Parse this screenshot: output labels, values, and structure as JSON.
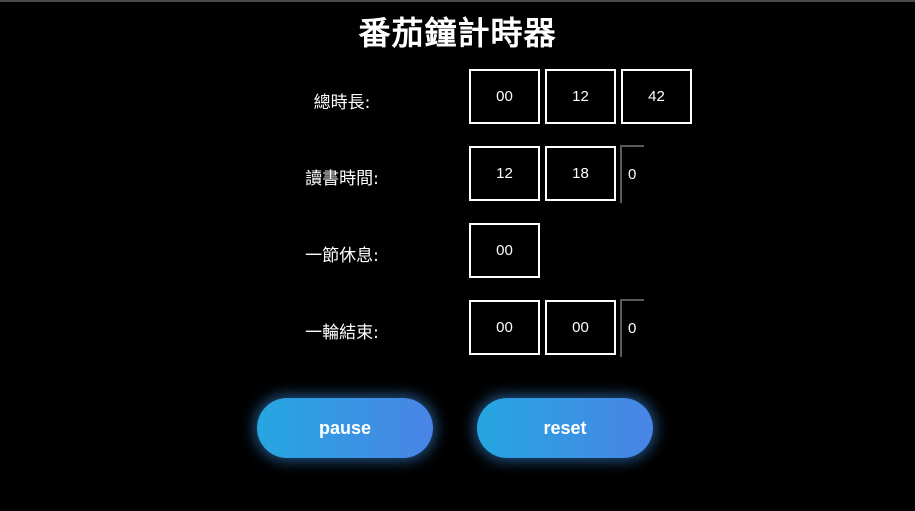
{
  "title": "番茄鐘計時器",
  "rows": [
    {
      "label": "總時長:",
      "cells": [
        "00",
        "12",
        "42"
      ],
      "stub": ""
    },
    {
      "label": "讀書時間:",
      "cells": [
        "12",
        "18"
      ],
      "stub": "0"
    },
    {
      "label": "一節休息:",
      "cells": [
        "00"
      ],
      "stub": ""
    },
    {
      "label": "一輪結束:",
      "cells": [
        "00",
        "00"
      ],
      "stub": "0"
    }
  ],
  "buttons": {
    "pause": "pause",
    "reset": "reset"
  },
  "colors": {
    "background": "#000000",
    "text": "#ffffff",
    "button_gradient_start": "#25a6e0",
    "button_gradient_end": "#4a84e6"
  }
}
